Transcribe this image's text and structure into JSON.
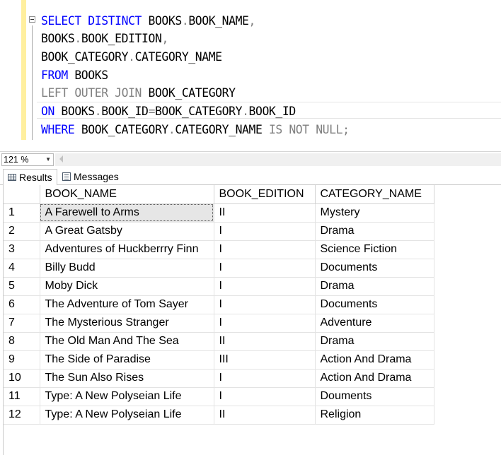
{
  "editor": {
    "lines": [
      [
        {
          "t": "SELECT DISTINCT ",
          "c": "kw"
        },
        {
          "t": "BOOKS",
          "c": "pl"
        },
        {
          "t": ".",
          "c": "gr"
        },
        {
          "t": "BOOK_NAME",
          "c": "pl"
        },
        {
          "t": ",",
          "c": "gr"
        }
      ],
      [
        {
          "t": "BOOKS",
          "c": "pl"
        },
        {
          "t": ".",
          "c": "gr"
        },
        {
          "t": "BOOK_EDITION",
          "c": "pl"
        },
        {
          "t": ",",
          "c": "gr"
        }
      ],
      [
        {
          "t": "BOOK_CATEGORY",
          "c": "pl"
        },
        {
          "t": ".",
          "c": "gr"
        },
        {
          "t": "CATEGORY_NAME",
          "c": "pl"
        }
      ],
      [
        {
          "t": "FROM ",
          "c": "kw"
        },
        {
          "t": "BOOKS",
          "c": "pl"
        }
      ],
      [
        {
          "t": "LEFT OUTER JOIN ",
          "c": "gr"
        },
        {
          "t": "BOOK_CATEGORY",
          "c": "pl"
        }
      ],
      [
        {
          "t": "ON ",
          "c": "kw"
        },
        {
          "t": "BOOKS",
          "c": "pl"
        },
        {
          "t": ".",
          "c": "gr"
        },
        {
          "t": "BOOK_ID",
          "c": "pl"
        },
        {
          "t": "=",
          "c": "gr"
        },
        {
          "t": "BOOK_CATEGORY",
          "c": "pl"
        },
        {
          "t": ".",
          "c": "gr"
        },
        {
          "t": "BOOK_ID",
          "c": "pl"
        }
      ],
      [
        {
          "t": "WHERE ",
          "c": "kw"
        },
        {
          "t": "BOOK_CATEGORY",
          "c": "pl"
        },
        {
          "t": ".",
          "c": "gr"
        },
        {
          "t": "CATEGORY_NAME ",
          "c": "pl"
        },
        {
          "t": "IS NOT NULL;",
          "c": "gr"
        }
      ]
    ]
  },
  "zoom": {
    "value": "121 %"
  },
  "tabs": {
    "results_label": "Results",
    "messages_label": "Messages"
  },
  "grid": {
    "columns": [
      "BOOK_NAME",
      "BOOK_EDITION",
      "CATEGORY_NAME"
    ],
    "rows": [
      [
        "1",
        "A Farewell to Arms",
        "II",
        "Mystery"
      ],
      [
        "2",
        "A Great Gatsby",
        "I",
        "Drama"
      ],
      [
        "3",
        "Adventures of Huckberrry Finn",
        "I",
        "Science Fiction"
      ],
      [
        "4",
        "Billy Budd",
        "I",
        "Documents"
      ],
      [
        "5",
        "Moby Dick",
        "I",
        "Drama"
      ],
      [
        "6",
        "The Adventure of Tom Sayer",
        "I",
        "Documents"
      ],
      [
        "7",
        "The Mysterious Stranger",
        "I",
        "Adventure"
      ],
      [
        "8",
        "The Old Man And The Sea",
        "II",
        "Drama"
      ],
      [
        "9",
        "The Side of Paradise",
        "III",
        "Action And Drama"
      ],
      [
        "10",
        "The Sun Also Rises",
        "I",
        "Action And Drama"
      ],
      [
        "11",
        "Type: A New Polyseian Life",
        "I",
        "Douments"
      ],
      [
        "12",
        "Type: A New Polyseian Life",
        "II",
        "Religion"
      ]
    ]
  },
  "colors": {
    "keyword": "#0000ff",
    "operator": "#808080",
    "gutter": "#ffef9e"
  }
}
